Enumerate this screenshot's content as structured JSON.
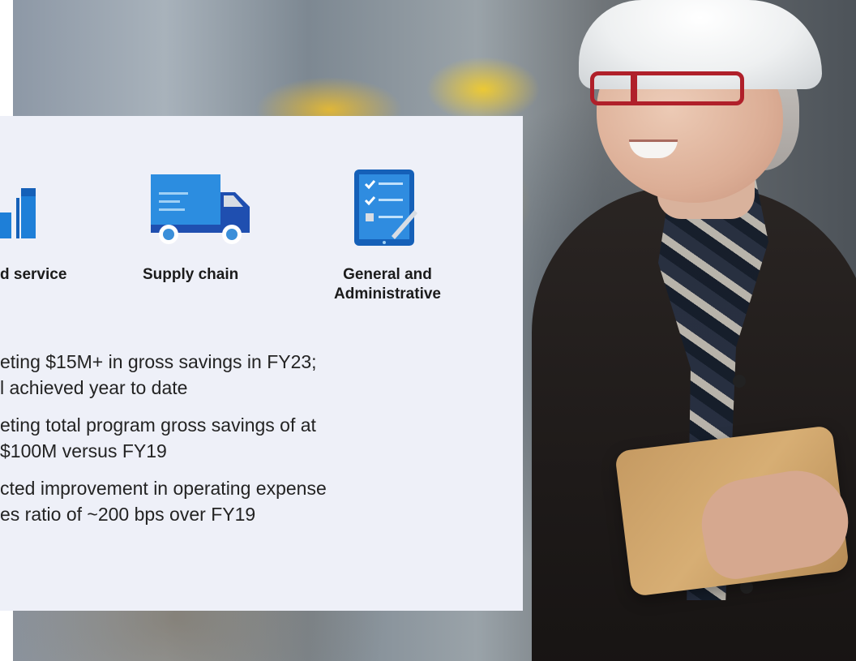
{
  "slide": {
    "tiles": [
      {
        "icon": "bar-chart-icon",
        "label": "d service"
      },
      {
        "icon": "delivery-truck-icon",
        "label": "Supply chain"
      },
      {
        "icon": "checklist-tablet-icon",
        "label_line1": "General and",
        "label_line2": "Administrative"
      }
    ],
    "bullets": [
      {
        "line1": "eting $15M+ in gross savings in FY23;",
        "line2": "l achieved year to date"
      },
      {
        "line1": "eting total program gross savings of at",
        "line2": " $100M versus FY19"
      },
      {
        "line1": "cted improvement in operating expense",
        "line2": "es ratio of ~200 bps over FY19"
      }
    ],
    "colors": {
      "panel_bg": "#eef0f8",
      "icon_blue": "#1e7fd8",
      "icon_dark_blue": "#1560b8",
      "icon_light": "#d8dde4"
    },
    "photo": "woman-in-white-hard-hat-holding-tablet"
  }
}
